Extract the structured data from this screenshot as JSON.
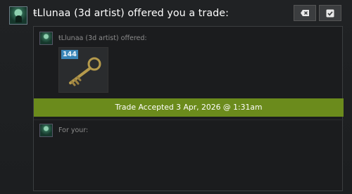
{
  "header": {
    "title": "ŧLlunaa (3d artist) offered you a trade:"
  },
  "buttons": {
    "decline_icon": "tag-cross-icon",
    "accept_icon": "checkmark-icon"
  },
  "offer": {
    "theirs_label": "ŧLlunaa (3d artist) offered:",
    "item": {
      "icon": "key-icon",
      "quantity": "144"
    },
    "status_banner": "Trade Accepted 3 Apr, 2026 @ 1:31am",
    "yours_label": "For your:"
  },
  "colors": {
    "background": "#1d1f21",
    "accepted_green": "#6b8b1c",
    "quantity_badge": "#3a86b8",
    "key_gold": "#b59a4c"
  }
}
